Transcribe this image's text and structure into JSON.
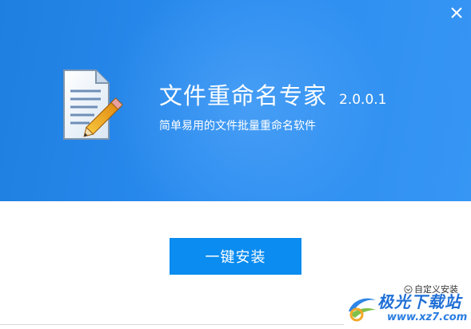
{
  "window": {
    "close_icon": "close-icon"
  },
  "banner": {
    "app_icon": "document-pencil-icon",
    "title": "文件重命名专家",
    "version": "2.0.0.1",
    "subtitle": "简单易用的文件批量重命名软件"
  },
  "actions": {
    "install_label": "一键安装",
    "custom_install_label": "自定义安装",
    "custom_install_icon": "chevron-down-circle-icon"
  },
  "watermark": {
    "title": "极光下载站",
    "url": "www.xz7.com"
  },
  "colors": {
    "banner_start": "#1f7fe0",
    "banner_end": "#3796f4",
    "install_button": "#0a8cf0",
    "watermark": "#1f6fd6"
  }
}
